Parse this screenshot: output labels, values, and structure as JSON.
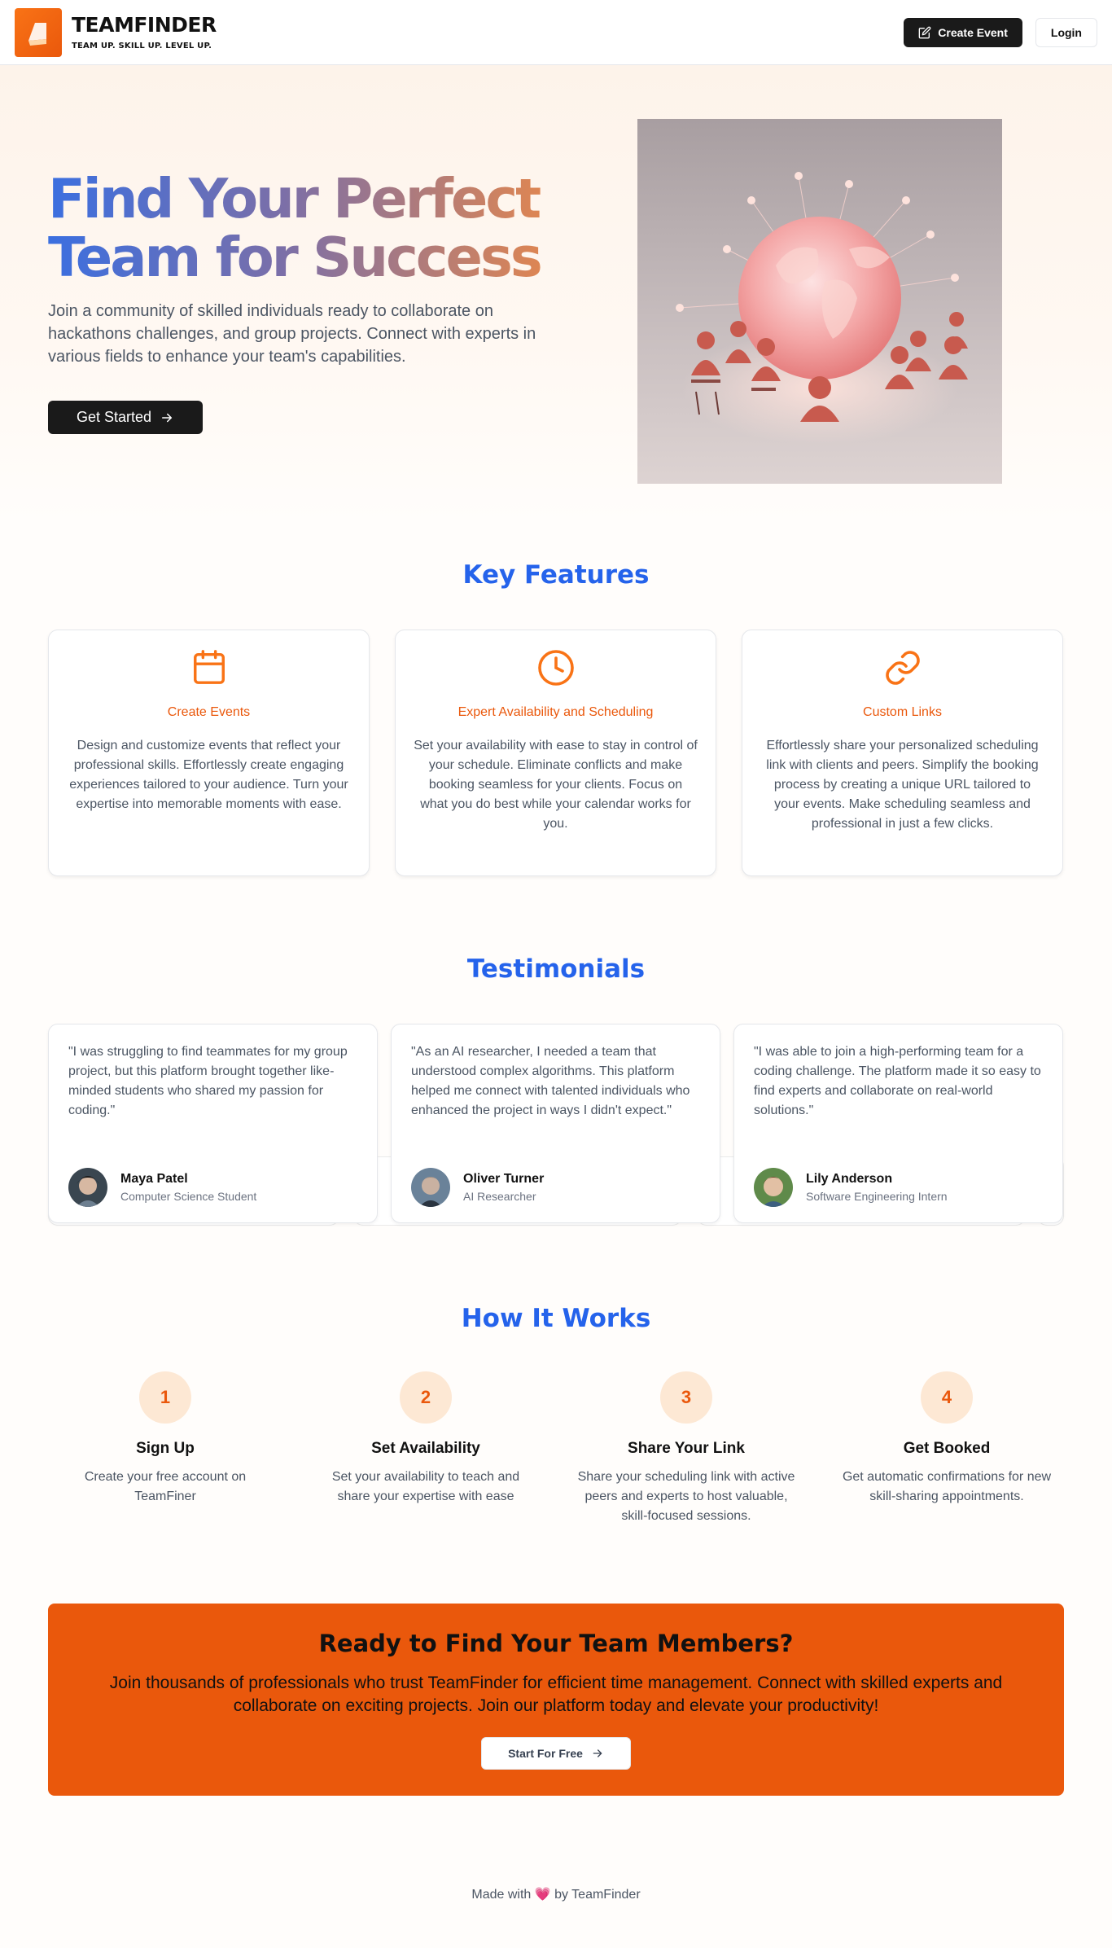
{
  "header": {
    "brand_name": "TEAMFINDER",
    "brand_tagline": "TEAM UP. SKILL UP. LEVEL UP.",
    "create_event_label": "Create Event",
    "login_label": "Login"
  },
  "hero": {
    "title_line1": "Find Your Perfect",
    "title_line2": "Team for Success",
    "subtitle": "Join a community of skilled individuals ready to collaborate on hackathons challenges, and group projects. Connect with experts in various fields to enhance your team's capabilities.",
    "cta_label": "Get Started"
  },
  "features": {
    "title": "Key Features",
    "items": [
      {
        "icon": "calendar-icon",
        "title": "Create Events",
        "description": "Design and customize events that reflect your professional skills. Effortlessly create engaging experiences tailored to your audience. Turn your expertise into memorable moments with ease."
      },
      {
        "icon": "clock-icon",
        "title": "Expert Availability and Scheduling",
        "description": "Set your availability with ease to stay in control of your schedule. Eliminate conflicts and make booking seamless for your clients. Focus on what you do best while your calendar works for you."
      },
      {
        "icon": "link-icon",
        "title": "Custom Links",
        "description": "Effortlessly share your personalized scheduling link with clients and peers. Simplify the booking process by creating a unique URL tailored to your events. Make scheduling seamless and professional in just a few clicks."
      }
    ]
  },
  "testimonials": {
    "title": "Testimonials",
    "items": [
      {
        "quote": "\"I was struggling to find teammates for my group project, but this platform brought together like-minded students who shared my passion for coding.\"",
        "name": "Maya Patel",
        "role": "Computer Science Student"
      },
      {
        "quote": "\"As an AI researcher, I needed a team that understood complex algorithms. This platform helped me connect with talented individuals who enhanced the project in ways I didn't expect.\"",
        "name": "Oliver Turner",
        "role": "AI Researcher"
      },
      {
        "quote": "\"I was able to join a high-performing team for a coding challenge. The platform made it so easy to find experts and collaborate on real-world solutions.\"",
        "name": "Lily Anderson",
        "role": "Software Engineering Intern"
      }
    ]
  },
  "how_it_works": {
    "title": "How It Works",
    "steps": [
      {
        "number": "1",
        "title": "Sign Up",
        "description": "Create your free account on TeamFiner"
      },
      {
        "number": "2",
        "title": "Set Availability",
        "description": "Set your availability to teach and share your expertise with ease"
      },
      {
        "number": "3",
        "title": "Share Your Link",
        "description": "Share your scheduling link with active peers and experts to host valuable, skill-focused sessions."
      },
      {
        "number": "4",
        "title": "Get Booked",
        "description": "Get automatic confirmations for new skill-sharing appointments."
      }
    ]
  },
  "cta": {
    "title": "Ready to Find Your Team Members?",
    "description": "Join thousands of professionals who trust TeamFinder for efficient time management. Connect with skilled experts and collaborate on exciting projects. Join our platform today and elevate your productivity!",
    "button_label": "Start For Free"
  },
  "footer": {
    "made_with": "Made with",
    "heart": "💗",
    "by": "by TeamFinder"
  },
  "colors": {
    "accent_orange": "#ea580c",
    "accent_blue": "#2563eb",
    "dark": "#1a1a1a"
  }
}
